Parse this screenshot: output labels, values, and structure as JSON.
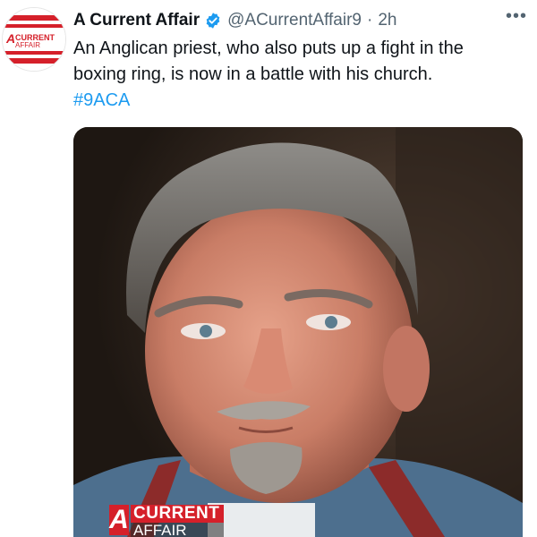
{
  "tweet": {
    "display_name": "A Current Affair",
    "handle": "@ACurrentAffair9",
    "separator": "·",
    "time": "2h",
    "text_line1": "An Anglican priest, who also puts up a fight in the",
    "text_line2": "boxing ring, is now in a battle with his church.",
    "hashtag": "#9ACA",
    "more_label": "•••"
  },
  "avatar": {
    "logo_line1": "CURRENT",
    "logo_line2": "AFFAIR",
    "logo_letter": "A"
  },
  "media": {
    "bug_letter": "A",
    "bug_line1": "CURRENT",
    "bug_line2": "AFFAIR",
    "icon": "photo-of-man"
  },
  "colors": {
    "brand_red": "#d5202a",
    "link_blue": "#1d9bf0",
    "muted_text": "#536471",
    "verified_blue": "#1d9bf0"
  }
}
